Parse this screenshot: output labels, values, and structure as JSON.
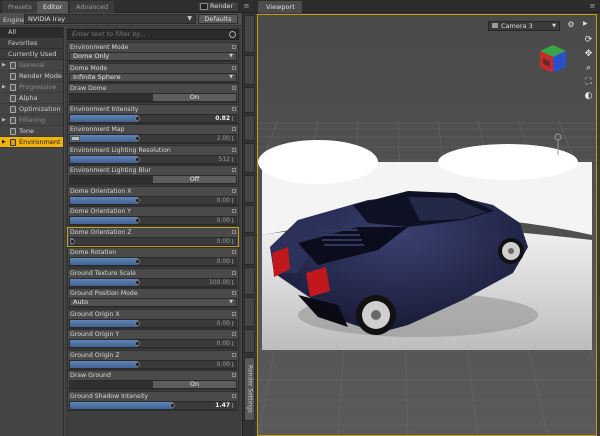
{
  "top_tabs": {
    "presets": "Presets",
    "editor": "Editor",
    "advanced": "Advanced",
    "render": "Render"
  },
  "engine": {
    "label": "Engine :",
    "value": "NVIDIA Iray",
    "defaults": "Defaults"
  },
  "categories": [
    {
      "label": "All",
      "level": "top",
      "selected": true
    },
    {
      "label": "Favorites",
      "level": "top"
    },
    {
      "label": "Currently Used",
      "level": "top"
    },
    {
      "label": "General",
      "level": "group",
      "dim": true,
      "expand": "▶"
    },
    {
      "label": "Render Mode",
      "level": "sub"
    },
    {
      "label": "Progressive ...",
      "level": "group",
      "dim": true,
      "expand": "▶"
    },
    {
      "label": "Alpha",
      "level": "sub"
    },
    {
      "label": "Optimization",
      "level": "sub"
    },
    {
      "label": "Filtering",
      "level": "group",
      "dim": true,
      "expand": "▶"
    },
    {
      "label": "Tone Mapping",
      "level": "sub"
    },
    {
      "label": "Environment",
      "level": "group",
      "active": true,
      "expand": "▶"
    }
  ],
  "filter": {
    "placeholder": "Enter text to filter by..."
  },
  "properties": [
    {
      "label": "Environment Mode",
      "kind": "dropdown",
      "value": "Dome Only"
    },
    {
      "label": "Dome Mode",
      "kind": "dropdown",
      "value": "Infinite Sphere"
    },
    {
      "label": "Draw Dome",
      "kind": "toggle",
      "value": "On"
    },
    {
      "label": "Environment Intensity",
      "kind": "slider",
      "value": "0.82",
      "level": 0.41,
      "bright": true
    },
    {
      "label": "Environment Map",
      "kind": "map",
      "value": "2.00"
    },
    {
      "label": "Environment Lighting Resolution",
      "kind": "slider",
      "value": "512",
      "level": 0.41
    },
    {
      "label": "Environment Lighting Blur",
      "kind": "toggle",
      "value": "Off"
    },
    {
      "label": "Dome Orientation X",
      "kind": "slider",
      "value": "0.00",
      "level": 0.41
    },
    {
      "label": "Dome Orientation Y",
      "kind": "slider",
      "value": "0.00",
      "level": 0.41
    },
    {
      "label": "Dome Orientation Z",
      "kind": "slider",
      "value": "0.00",
      "level": 0.02,
      "outlined": true
    },
    {
      "label": "Dome Rotation",
      "kind": "slider",
      "value": "0.00",
      "level": 0.41
    },
    {
      "label": "Ground Texture Scale",
      "kind": "slider",
      "value": "100.00",
      "level": 0.41
    },
    {
      "label": "Ground Position Mode",
      "kind": "dropdown",
      "value": "Auto"
    },
    {
      "label": "Ground Origin X",
      "kind": "slider",
      "value": "0.00",
      "level": 0.41
    },
    {
      "label": "Ground Origin Y",
      "kind": "slider",
      "value": "0.00",
      "level": 0.41
    },
    {
      "label": "Ground Origin Z",
      "kind": "slider",
      "value": "0.00",
      "level": 0.41
    },
    {
      "label": "Draw Ground",
      "kind": "toggle",
      "value": "On"
    },
    {
      "label": "Ground Shadow Intensity",
      "kind": "slider",
      "value": "1.47",
      "level": 0.62,
      "bright": true
    }
  ],
  "side_tabs": {
    "render_settings": "Render Settings"
  },
  "viewport": {
    "tab": "Viewport",
    "camera": "Camera 3"
  },
  "colors": {
    "accent": "#f1b40d",
    "slider_fill": "#4f73a6",
    "viewport_border": "#c99a0f",
    "car_body": "#1a1d3c"
  },
  "icons": {
    "render": "render-icon",
    "search": "search-icon",
    "gear": "gear-icon",
    "navcube": "navcube-icon"
  }
}
